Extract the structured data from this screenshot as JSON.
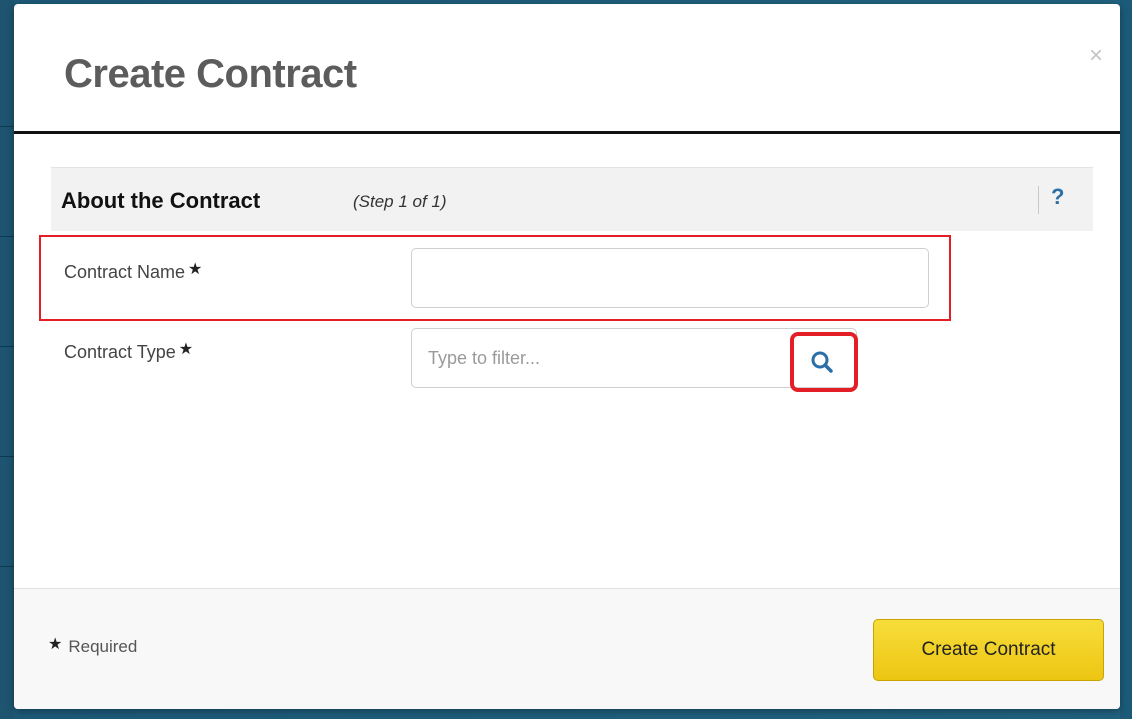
{
  "modal": {
    "title": "Create Contract",
    "close_glyph": "×"
  },
  "section": {
    "title": "About the Contract",
    "step": "(Step 1 of 1)",
    "help_glyph": "?"
  },
  "fields": {
    "contract_name": {
      "label": "Contract Name",
      "value": "",
      "placeholder": ""
    },
    "contract_type": {
      "label": "Contract Type",
      "value": "",
      "placeholder": "Type to filter..."
    }
  },
  "required_glyph": "★",
  "footer": {
    "required_label": "Required",
    "submit_label": "Create Contract"
  },
  "colors": {
    "backdrop": "#1f5d7a",
    "highlight": "#e41e26",
    "primary_button": "#f2d024",
    "help_icon": "#2a6fa8",
    "search_icon": "#2a6fa8"
  },
  "icons": {
    "close": "close-icon",
    "help": "help-icon",
    "search": "search-icon",
    "required": "star-icon"
  }
}
